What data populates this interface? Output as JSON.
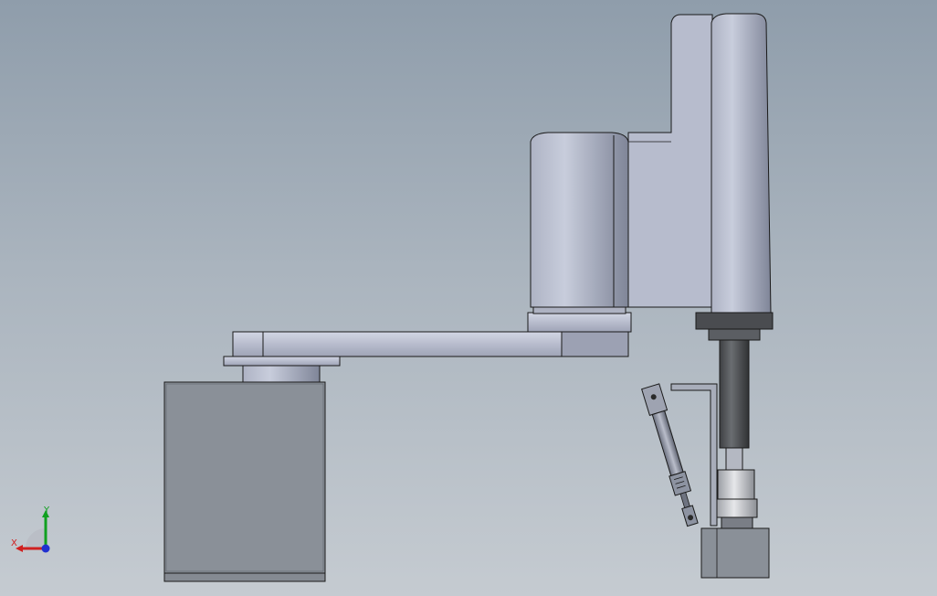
{
  "triad": {
    "x_label": "X",
    "y_label": "Y",
    "x_color": "#d02020",
    "y_color": "#10a020",
    "z_color": "#2030d0"
  },
  "colors": {
    "background_top": "#8f9dab",
    "background_bottom": "#c5cbd1",
    "body_light": "#c9cfdf",
    "body_dark": "#8a90a3",
    "outline": "#1a1a1a",
    "base_box": "#8a9098",
    "shaft": "#4f5256"
  }
}
